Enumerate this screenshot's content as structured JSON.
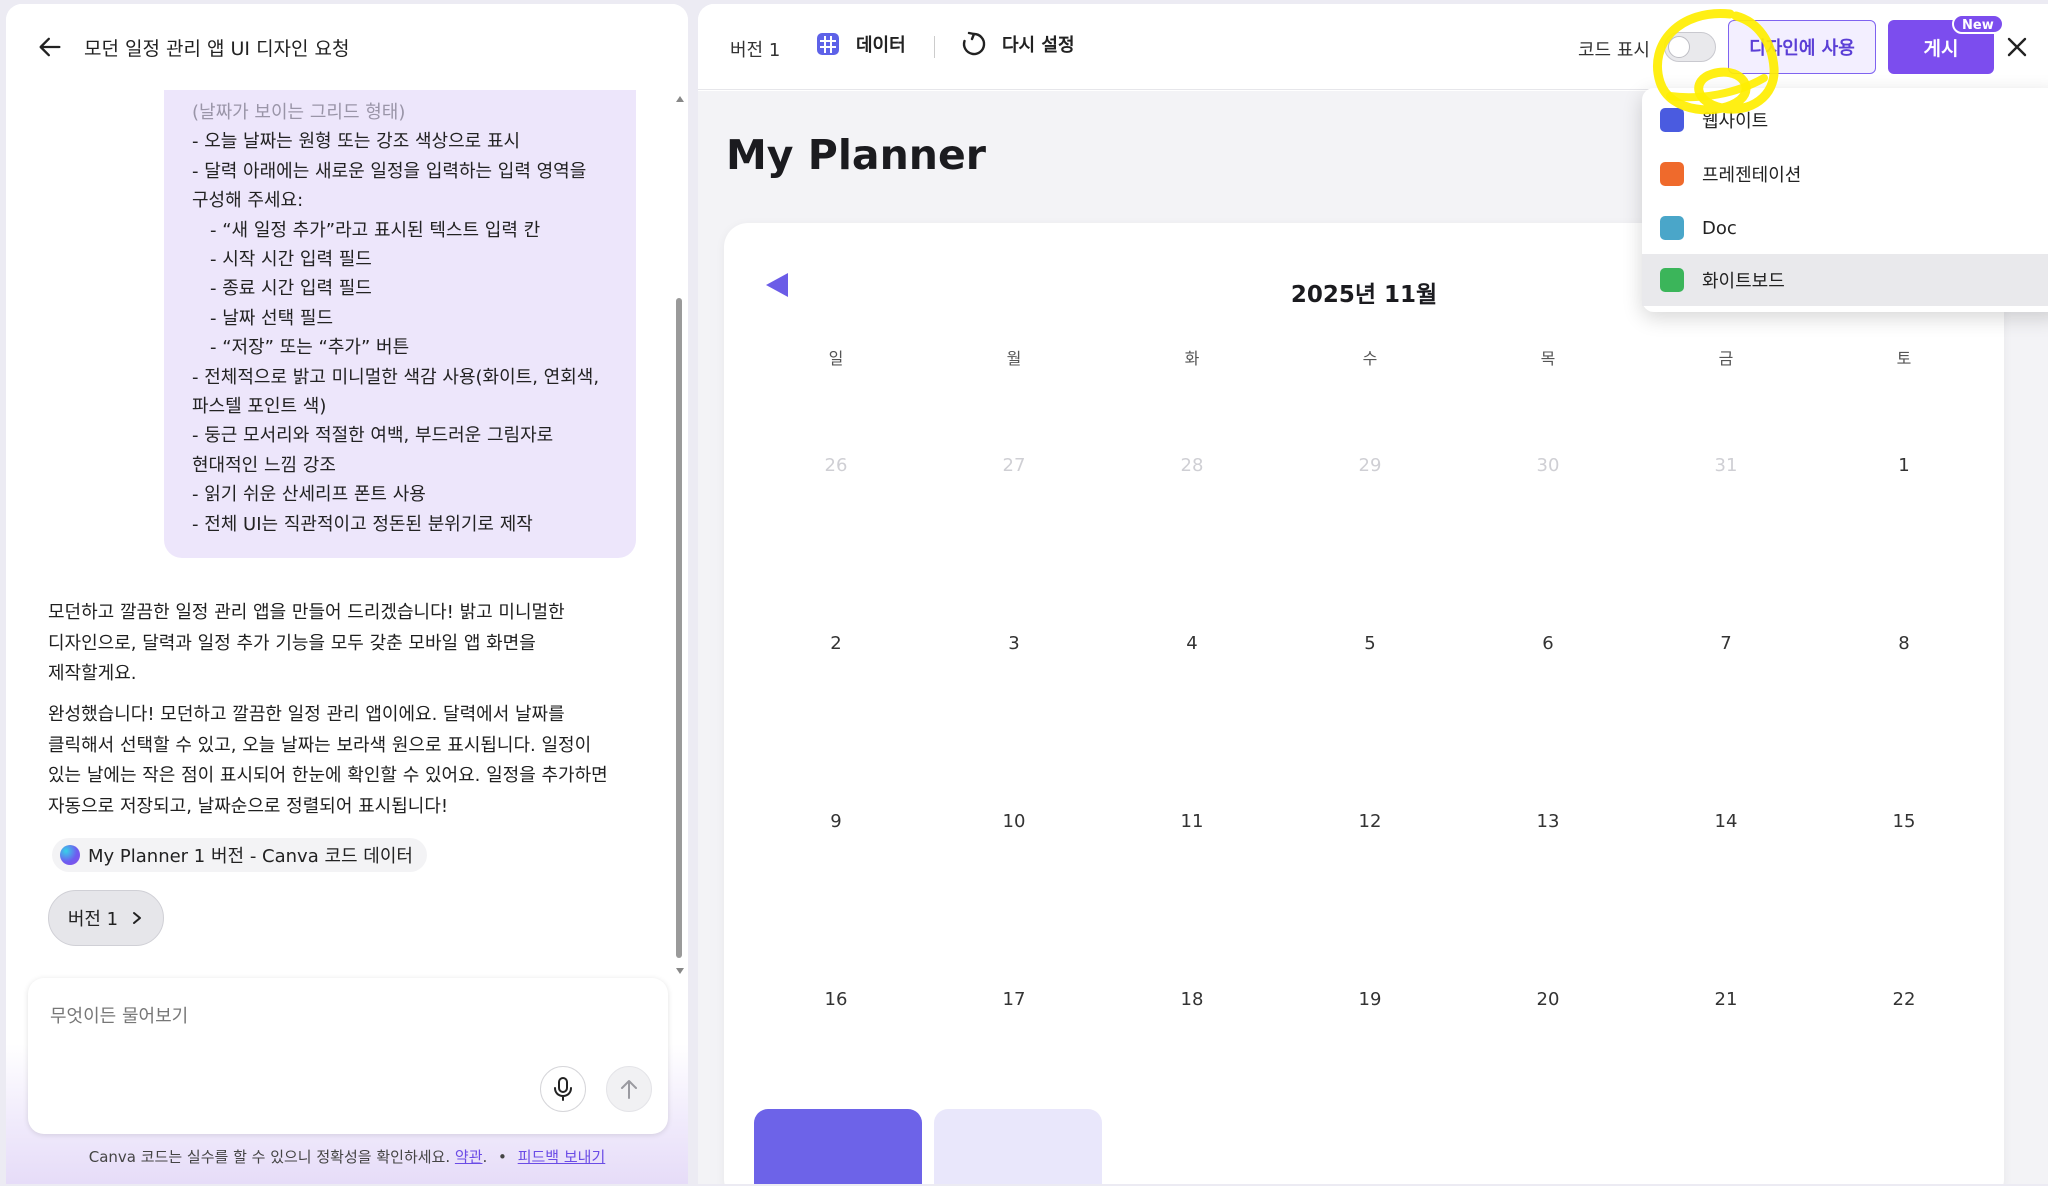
{
  "chat": {
    "title": "모던 일정 관리 앱 UI 디자인 요청",
    "user_message_lines": [
      {
        "text": "(날짜가 보이는 그리드 형태)",
        "indent": false,
        "faded": true
      },
      {
        "text": "- 오늘 날짜는 원형 또는 강조 색상으로 표시",
        "indent": false,
        "faded": false
      },
      {
        "text": "- 달력 아래에는 새로운 일정을 입력하는 입력 영역을",
        "indent": false,
        "faded": false
      },
      {
        "text": "구성해 주세요:",
        "indent": false,
        "faded": false
      },
      {
        "text": "- “새 일정 추가”라고 표시된 텍스트 입력 칸",
        "indent": true,
        "faded": false
      },
      {
        "text": "- 시작 시간 입력 필드",
        "indent": true,
        "faded": false
      },
      {
        "text": "- 종료 시간 입력 필드",
        "indent": true,
        "faded": false
      },
      {
        "text": "- 날짜 선택 필드",
        "indent": true,
        "faded": false
      },
      {
        "text": "- “저장” 또는 “추가” 버튼",
        "indent": true,
        "faded": false
      },
      {
        "text": "- 전체적으로 밝고 미니멀한 색감 사용(화이트, 연회색,",
        "indent": false,
        "faded": false
      },
      {
        "text": "파스텔 포인트 색)",
        "indent": false,
        "faded": false
      },
      {
        "text": "- 둥근 모서리와 적절한 여백, 부드러운 그림자로",
        "indent": false,
        "faded": false
      },
      {
        "text": "현대적인 느낌 강조",
        "indent": false,
        "faded": false
      },
      {
        "text": "- 읽기 쉬운 산세리프 폰트 사용",
        "indent": false,
        "faded": false
      },
      {
        "text": "- 전체 UI는 직관적이고 정돈된 분위기로 제작",
        "indent": false,
        "faded": false
      }
    ],
    "assistant_msg1_lines": [
      "모던하고 깔끔한 일정 관리 앱을 만들어 드리겠습니다! 밝고 미니멀한",
      "디자인으로, 달력과 일정 추가 기능을 모두 갖춘 모바일 앱 화면을",
      "제작할게요."
    ],
    "assistant_msg2_lines": [
      "완성했습니다! 모던하고 깔끔한 일정 관리 앱이에요. 달력에서 날짜를",
      "클릭해서 선택할 수 있고, 오늘 날짜는 보라색 원으로 표시됩니다. 일정이",
      "있는 날에는 작은 점이 표시되어 한눈에 확인할 수 있어요. 일정을 추가하면",
      "자동으로 저장되고, 날짜순으로 정렬되어 표시됩니다!"
    ],
    "data_chip_label": "My Planner 1 버전 - Canva 코드 데이터",
    "version_pill_label": "버전 1",
    "input_placeholder": "무엇이든 물어보기",
    "footer_text": "Canva 코드는 실수를 할 수 있으니 정확성을 확인하세요.",
    "footer_link_terms": "약관",
    "footer_dot": "•",
    "footer_link_feedback": "피드백 보내기"
  },
  "toolbar": {
    "version_label": "버전 1",
    "data_label": "데이터",
    "reset_label": "다시 설정",
    "code_toggle_label": "코드 표시",
    "code_toggle_on": false,
    "use_in_design_label": "디자인에 사용",
    "publish_label": "게시",
    "new_badge": "New"
  },
  "preview": {
    "app_title": "My Planner",
    "month_label": "2025년 11월",
    "weekdays": [
      "일",
      "월",
      "화",
      "수",
      "목",
      "금",
      "토"
    ],
    "weeks": [
      [
        {
          "d": "26",
          "muted": true
        },
        {
          "d": "27",
          "muted": true
        },
        {
          "d": "28",
          "muted": true
        },
        {
          "d": "29",
          "muted": true
        },
        {
          "d": "30",
          "muted": true
        },
        {
          "d": "31",
          "muted": true
        },
        {
          "d": "1",
          "muted": false
        }
      ],
      [
        {
          "d": "2",
          "muted": false
        },
        {
          "d": "3",
          "muted": false
        },
        {
          "d": "4",
          "muted": false
        },
        {
          "d": "5",
          "muted": false
        },
        {
          "d": "6",
          "muted": false
        },
        {
          "d": "7",
          "muted": false
        },
        {
          "d": "8",
          "muted": false
        }
      ],
      [
        {
          "d": "9",
          "muted": false
        },
        {
          "d": "10",
          "muted": false
        },
        {
          "d": "11",
          "muted": false
        },
        {
          "d": "12",
          "muted": false
        },
        {
          "d": "13",
          "muted": false
        },
        {
          "d": "14",
          "muted": false
        },
        {
          "d": "15",
          "muted": false
        }
      ],
      [
        {
          "d": "16",
          "muted": false
        },
        {
          "d": "17",
          "muted": false
        },
        {
          "d": "18",
          "muted": false
        },
        {
          "d": "19",
          "muted": false
        },
        {
          "d": "20",
          "muted": false
        },
        {
          "d": "21",
          "muted": false
        },
        {
          "d": "22",
          "muted": false
        }
      ]
    ]
  },
  "dropdown": {
    "items": [
      {
        "label": "웹사이트",
        "icon": "website-icon",
        "color": "#4a5be0",
        "active": false
      },
      {
        "label": "프레젠테이션",
        "icon": "presentation-icon",
        "color": "#ef6a2c",
        "active": false
      },
      {
        "label": "Doc",
        "icon": "doc-icon",
        "color": "#4aa6c9",
        "active": false
      },
      {
        "label": "화이트보드",
        "icon": "whiteboard-icon",
        "color": "#3bb55a",
        "active": true
      }
    ]
  },
  "colors": {
    "accent": "#7c4dee",
    "calendar_accent": "#6d63e8",
    "bubble": "#ede6fb",
    "highlight": "#ffee00"
  }
}
